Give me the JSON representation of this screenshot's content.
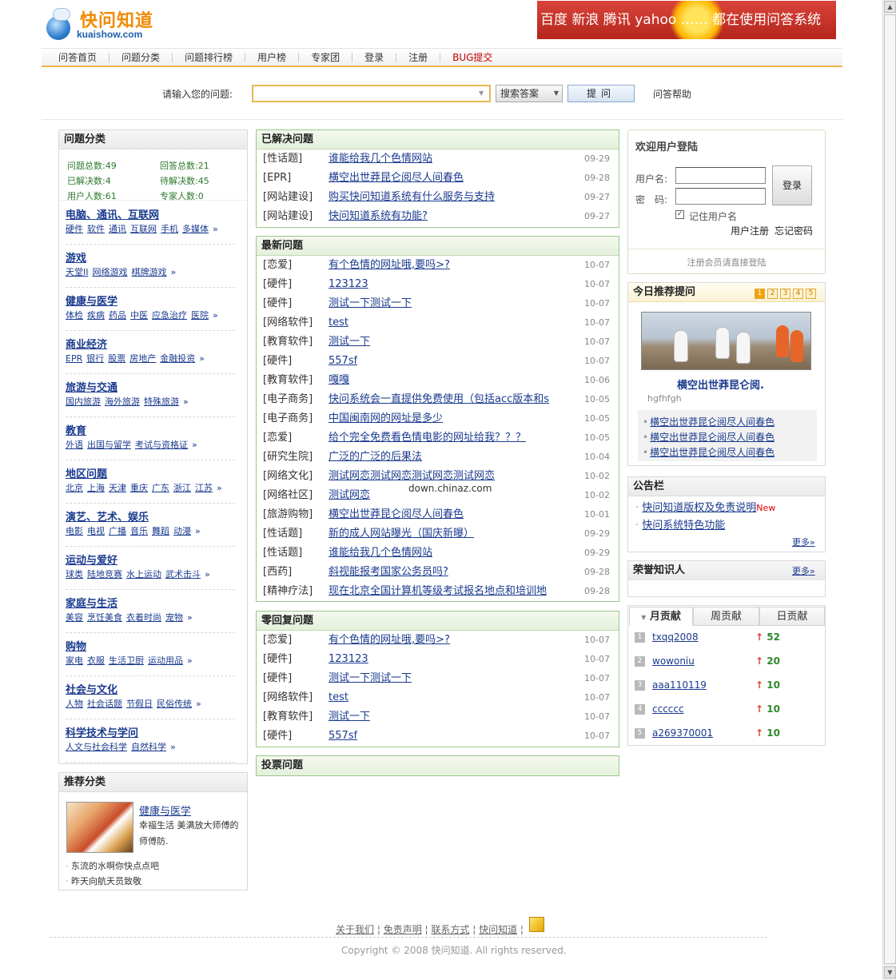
{
  "header": {
    "logo_cn": "快问知道",
    "logo_en": "kuaishow.com",
    "banner_text": "百度 新浪 腾讯 yahoo …… 都在使用问答系统"
  },
  "nav": [
    "问答首页",
    "问题分类",
    "问题排行榜",
    "用户榜",
    "专家团",
    "登录",
    "注册",
    "BUG提交"
  ],
  "search": {
    "label": "请输入您的问题:",
    "value": "",
    "search_button": "搜索答案",
    "ask_button": "提问",
    "help": "问答帮助"
  },
  "categories": {
    "title": "问题分类",
    "stats": [
      {
        "label": "问题总数:",
        "value": "49"
      },
      {
        "label": "回答总数:",
        "value": "21"
      },
      {
        "label": "已解决数:",
        "value": "4"
      },
      {
        "label": "待解决数:",
        "value": "45"
      },
      {
        "label": "用户人数:",
        "value": "61"
      },
      {
        "label": "专家人数:",
        "value": "0"
      }
    ],
    "items": [
      {
        "title": "电脑、通讯、互联网",
        "subs": [
          "硬件",
          "软件",
          "通讯",
          "互联网",
          "手机",
          "多媒体"
        ]
      },
      {
        "title": "游戏",
        "subs": [
          "天堂II",
          "网络游戏",
          "棋牌游戏"
        ]
      },
      {
        "title": "健康与医学",
        "subs": [
          "体检",
          "疾病",
          "药品",
          "中医",
          "应急治疗",
          "医院"
        ]
      },
      {
        "title": "商业经济",
        "subs": [
          "EPR",
          "银行",
          "股票",
          "房地产",
          "金融投资"
        ]
      },
      {
        "title": "旅游与交通",
        "subs": [
          "国内旅游",
          "海外旅游",
          "特殊旅游"
        ]
      },
      {
        "title": "教育",
        "subs": [
          "外语",
          "出国与留学",
          "考试与资格证"
        ]
      },
      {
        "title": "地区问题",
        "subs": [
          "北京",
          "上海",
          "天津",
          "重庆",
          "广东",
          "浙江",
          "江苏"
        ]
      },
      {
        "title": "演艺、艺术、娱乐",
        "subs": [
          "电影",
          "电视",
          "广播",
          "音乐",
          "舞蹈",
          "动漫"
        ]
      },
      {
        "title": "运动与爱好",
        "subs": [
          "球类",
          "陆地竞赛",
          "水上运动",
          "武术击斗"
        ]
      },
      {
        "title": "家庭与生活",
        "subs": [
          "美容",
          "烹饪美食",
          "衣着时尚",
          "宠物"
        ]
      },
      {
        "title": "购物",
        "subs": [
          "家电",
          "衣服",
          "生活卫厨",
          "运动用品"
        ]
      },
      {
        "title": "社会与文化",
        "subs": [
          "人物",
          "社会话题",
          "节假日",
          "民俗传统"
        ]
      },
      {
        "title": "科学技术与学问",
        "subs": [
          "人文与社会科学",
          "自然科学"
        ]
      }
    ],
    "more": "»"
  },
  "recommended": {
    "title": "推荐分类",
    "feature_title": "健康与医学",
    "feature_desc": "幸福生活 美满放大师傅的师傅防.",
    "items": [
      "东流的水啊你快点点吧",
      "昨天向航天员致敬"
    ]
  },
  "solved": {
    "title": "已解决问题",
    "rows": [
      {
        "cat": "[性话题]",
        "title": "谁能给我几个色情网站",
        "date": "09-29"
      },
      {
        "cat": "[EPR]",
        "title": "横空出世莽昆仑阅尽人间春色",
        "date": "09-28"
      },
      {
        "cat": "[网站建设]",
        "title": "购买快问知道系统有什么服务与支持",
        "date": "09-27"
      },
      {
        "cat": "[网站建设]",
        "title": "快问知道系统有功能?",
        "date": "09-27"
      }
    ]
  },
  "latest": {
    "title": "最新问题",
    "rows": [
      {
        "cat": "[恋爱]",
        "title": "有个色情的网址哦,要吗>?",
        "date": "10-07"
      },
      {
        "cat": "[硬件]",
        "title": "123123",
        "date": "10-07"
      },
      {
        "cat": "[硬件]",
        "title": "测试一下测试一下",
        "date": "10-07"
      },
      {
        "cat": "[网络软件]",
        "title": "test",
        "date": "10-07"
      },
      {
        "cat": "[教育软件]",
        "title": "测试一下",
        "date": "10-07"
      },
      {
        "cat": "[硬件]",
        "title": "557sf",
        "date": "10-07"
      },
      {
        "cat": "[教育软件]",
        "title": "嘎嘎",
        "date": "10-06"
      },
      {
        "cat": "[电子商务]",
        "title": "快问系统会一直提供免费使用（包括acc版本和s",
        "date": "10-05"
      },
      {
        "cat": "[电子商务]",
        "title": "中国闽南网的网址是多少",
        "date": "10-05"
      },
      {
        "cat": "[恋爱]",
        "title": "给个完全免费看色情电影的网址给我？？？",
        "date": "10-05"
      },
      {
        "cat": "[研究生院]",
        "title": "广泛的广泛的后果法",
        "date": "10-04"
      },
      {
        "cat": "[网络文化]",
        "title": "测试网恋测试网恋测试网恋测试网恋",
        "date": "10-02"
      },
      {
        "cat": "[网络社区]",
        "title": "测试网恋",
        "date": "10-02"
      },
      {
        "cat": "[旅游购物]",
        "title": "横空出世莽昆仑阅尽人间春色",
        "date": "10-01"
      },
      {
        "cat": "[性话题]",
        "title": "新的成人网站曝光（国庆新曝）",
        "date": "09-29"
      },
      {
        "cat": "[性话题]",
        "title": "谁能给我几个色情网站",
        "date": "09-29"
      },
      {
        "cat": "[西药]",
        "title": "斜视能报考国家公务员吗?",
        "date": "09-28"
      },
      {
        "cat": "[精神疗法]",
        "title": "现在北京全国计算机等级考试报名地点和培训地",
        "date": "09-28"
      }
    ]
  },
  "zero_reply": {
    "title": "零回复问题",
    "rows": [
      {
        "cat": "[恋爱]",
        "title": "有个色情的网址哦,要吗>?",
        "date": "10-07"
      },
      {
        "cat": "[硬件]",
        "title": "123123",
        "date": "10-07"
      },
      {
        "cat": "[硬件]",
        "title": "测试一下测试一下",
        "date": "10-07"
      },
      {
        "cat": "[网络软件]",
        "title": "test",
        "date": "10-07"
      },
      {
        "cat": "[教育软件]",
        "title": "测试一下",
        "date": "10-07"
      },
      {
        "cat": "[硬件]",
        "title": "557sf",
        "date": "10-07"
      }
    ]
  },
  "vote": {
    "title": "投票问题"
  },
  "watermark": "down.chinaz.com",
  "login": {
    "title": "欢迎用户登陆",
    "username_label": "用户名:",
    "password_label": "密　码:",
    "login_button": "登录",
    "remember": "记住用户名",
    "register": "用户注册",
    "forgot": "忘记密码",
    "note": "注册会员请直接登陆"
  },
  "recommend_q": {
    "title": "今日推荐提问",
    "pages": [
      "1",
      "2",
      "3",
      "4",
      "5"
    ],
    "caption": "横空出世莽昆仑阅.",
    "sub": "hgfhfgh",
    "items": [
      "横空出世莽昆仑阅尽人间春色",
      "横空出世莽昆仑阅尽人间春色",
      "横空出世莽昆仑阅尽人间春色"
    ]
  },
  "notice": {
    "title": "公告栏",
    "items": [
      {
        "text": "快问知道版权及免责说明",
        "badge": "New"
      },
      {
        "text": "快问系统特色功能",
        "badge": ""
      }
    ],
    "more": "更多»"
  },
  "honor": {
    "title": "荣誉知识人",
    "more": "更多»"
  },
  "contrib": {
    "tabs": [
      "月贡献",
      "周贡献",
      "日贡献"
    ],
    "rows": [
      {
        "rank": "1",
        "user": "txqq2008",
        "score": "52"
      },
      {
        "rank": "2",
        "user": "wowoniu",
        "score": "20"
      },
      {
        "rank": "3",
        "user": "aaa110119",
        "score": "10"
      },
      {
        "rank": "4",
        "user": "cccccc",
        "score": "10"
      },
      {
        "rank": "5",
        "user": "a269370001",
        "score": "10"
      }
    ]
  },
  "footer": {
    "links": [
      "关于我们",
      "免责声明",
      "联系方式",
      "快问知道"
    ],
    "copyright": "Copyright © 2008 快问知道. All rights reserved."
  }
}
